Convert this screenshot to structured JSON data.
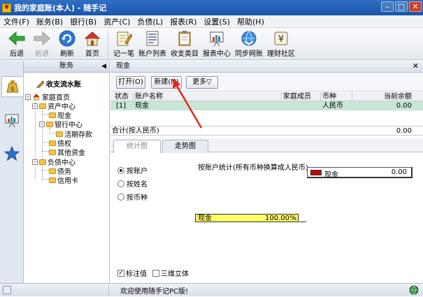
{
  "window": {
    "title": "我的家庭账(本人) - 随手记"
  },
  "menu": [
    "文件(F)",
    "账务(B)",
    "银行(B)",
    "资产(C)",
    "负债(L)",
    "报表(R)",
    "设置(S)",
    "帮助(H)"
  ],
  "toolbar": {
    "back": "后退",
    "forward": "前进",
    "refresh": "刷新",
    "home": "首页",
    "record": "记一笔",
    "accounts": "账户列表",
    "categories": "收支类目",
    "reports": "报表中心",
    "sync": "同步网账",
    "community": "理财社区"
  },
  "left_panel": {
    "title": "账务"
  },
  "tree": {
    "root": "收支流水账",
    "home": "家庭首页",
    "assets": "资产中心",
    "cash": "现金",
    "bank": "银行中心",
    "deposit": "活期存款",
    "claims": "债权",
    "other_funds": "其他资金",
    "liabilities": "负债中心",
    "debts": "债务",
    "credit_card": "信用卡"
  },
  "main": {
    "header": "现金",
    "buttons": {
      "open": "打开(O)",
      "new": "新建(N)",
      "more": "更多▽"
    },
    "columns": [
      "状态",
      "账户名称",
      "家庭成员",
      "币种",
      "当前余额"
    ],
    "rows": [
      {
        "status": "[1]",
        "name": "现金",
        "member": "",
        "currency": "人民币",
        "balance": "0.00"
      }
    ],
    "total_label": "合计(按人民币)",
    "total_value": "0.00"
  },
  "tabs": {
    "stats": "统计图",
    "trend": "走势图"
  },
  "stats": {
    "group_options": [
      "按账户",
      "按姓名",
      "按币种"
    ],
    "chart_title": "按账户统计(所有币种换算成人民币)",
    "legend_name": "现金",
    "legend_value": "0.00",
    "bar_label": "现金",
    "bar_value": "100.00",
    "bar_unit": "%",
    "bar_fraction": 1.0,
    "show_values": "标注值",
    "three_d": "三维立体"
  },
  "colors": {
    "legend_swatch": "#cc0000",
    "bar_fill": "#ffff66",
    "arrow": "#e8261c"
  },
  "status": {
    "text": "欢迎使用随手记PC版!"
  }
}
